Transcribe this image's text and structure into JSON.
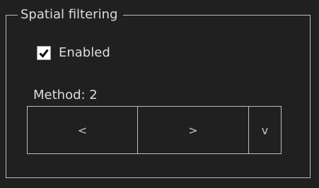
{
  "group": {
    "title": "Spatial filtering"
  },
  "enabled_checkbox": {
    "label": "Enabled",
    "checked": true
  },
  "method": {
    "label": "Method: 2"
  },
  "buttons": {
    "prev_label": "<",
    "next_label": ">",
    "dropdown_label": "v"
  },
  "colors": {
    "background": "#202020",
    "border": "#bcbcbc",
    "text": "#dcdcdc",
    "checkbox_fill": "#ffffff"
  },
  "icons": {
    "check": "checkmark-icon"
  }
}
